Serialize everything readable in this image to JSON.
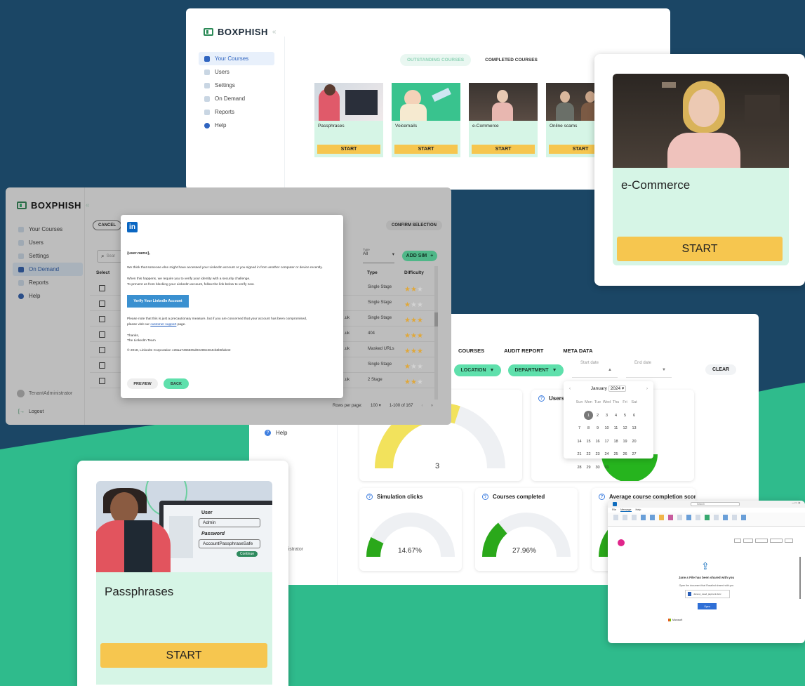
{
  "colors": {
    "bg_navy": "#1b4665",
    "bg_green": "#2fbb8c",
    "accent_green": "#5fe0ac",
    "start_yellow": "#f6c64f",
    "card_mint": "#d6f5e6",
    "linkedin_blue": "#0a66c2"
  },
  "courses_panel": {
    "logo": "BOXPHISH",
    "sidebar": [
      "Your Courses",
      "Users",
      "Settings",
      "On Demand",
      "Reports",
      "Help"
    ],
    "tabs": [
      "OUTSTANDING COURSES",
      "COMPLETED COURSES"
    ],
    "courses": [
      {
        "title": "Passphrases",
        "start": "START"
      },
      {
        "title": "Voicemails",
        "start": "START"
      },
      {
        "title": "e-Commerce",
        "start": "START"
      },
      {
        "title": "Online scams",
        "start": "START"
      }
    ]
  },
  "ecommerce_card": {
    "title": "e-Commerce",
    "start": "START"
  },
  "ondemand_panel": {
    "logo": "BOXPHISH",
    "sidebar": [
      "Your Courses",
      "Users",
      "Settings",
      "On Demand",
      "Reports",
      "Help"
    ],
    "tenant_admin": "TenantAdministrator",
    "logout": "Logout",
    "cancel": "CANCEL",
    "confirm": "CONFIRM SELECTION",
    "search_placeholder": "Sear",
    "type_filter_label": "Type",
    "type_filter_value": "All",
    "add_sim": "ADD SIM",
    "columns": {
      "select": "Select",
      "type": "Type",
      "difficulty": "Difficulty"
    },
    "rows": [
      {
        "partial": "",
        "type": "Single Stage",
        "stars": 2
      },
      {
        "partial": "",
        "type": "Single Stage",
        "stars": 1
      },
      {
        "partial": ".uk",
        "type": "Single Stage",
        "stars": 3
      },
      {
        "partial": ".uk",
        "type": "404",
        "stars": 3
      },
      {
        "partial": ".uk",
        "type": "Masked URLs",
        "stars": 3
      },
      {
        "partial": "",
        "type": "Single Stage",
        "stars": 1
      },
      {
        "partial": ".uk",
        "type": "2 Stage",
        "stars": 2
      }
    ],
    "pagination": {
      "rows_label": "Rows per page:",
      "rows_value": "100",
      "range": "1-100 of 167"
    }
  },
  "linkedin_modal": {
    "logo": "in",
    "greeting": "{user.name},",
    "p1": "We think that someone else might have accessed your LinkedIn account or you signed in from another computer or device recently.",
    "p2a": "When this happens, we require you to verify your identity with a security challenge.",
    "p2b": "To prevent us from blocking your LinkedIn account, follow the link below to verify now.",
    "verify_button": "Verify Your LinkedIn Account",
    "p3a": "Please note that this is just a precautionary measure, but if you are concerned that your account has been compromised,",
    "p3b_prefix": "please visit our ",
    "p3b_link": "customer support",
    "p3b_suffix": " page.",
    "thanks": "Thanks,",
    "team": "The LinkedIn Team",
    "copyright": "© 2018, LinkedIn Corporation c28aa7465505d03499e264cb6b5fab42",
    "preview": "PREVIEW",
    "back": "BACK"
  },
  "reports_panel": {
    "tabs": [
      "COURSES",
      "AUDIT REPORT",
      "META DATA"
    ],
    "filters": {
      "location": "LOCATION",
      "department": "DEPARTMENT",
      "start_date": "Start date",
      "end_date": "End date",
      "clear": "CLEAR"
    },
    "calendar": {
      "month": "January",
      "year": "2024",
      "weekdays": [
        "Sun",
        "Mon",
        "Tue",
        "Wed",
        "Thu",
        "Fri",
        "Sat"
      ],
      "weeks": [
        [
          "",
          "1",
          "2",
          "3",
          "4",
          "5",
          "6"
        ],
        [
          "7",
          "8",
          "9",
          "10",
          "11",
          "12",
          "13"
        ],
        [
          "14",
          "15",
          "16",
          "17",
          "18",
          "19",
          "20"
        ],
        [
          "21",
          "22",
          "23",
          "24",
          "25",
          "26",
          "27"
        ],
        [
          "28",
          "29",
          "30",
          "31",
          "",
          "",
          ""
        ]
      ],
      "selected": "1"
    },
    "sidebar_help": "Help",
    "admin_partial": "ryAdministrator",
    "users_card_title": "Users",
    "gauge_main": {
      "value": "3",
      "fraction": 0.6
    },
    "gauges": [
      {
        "title": "Simulation clicks",
        "value": "14.67%",
        "fraction": 0.1467
      },
      {
        "title": "Courses completed",
        "value": "27.96%",
        "fraction": 0.2796
      },
      {
        "title": "Average course completion score",
        "value": "",
        "fraction": 0.5
      }
    ]
  },
  "passphrases_card": {
    "user_label": "User",
    "user_value": "Admin",
    "password_label": "Password",
    "password_value": "AccountPassphraseSafe",
    "continue": "Continue",
    "title": "Passphrases",
    "start": "START"
  },
  "outlook_panel": {
    "search": "Search",
    "menu": [
      "File",
      "Message",
      "Help"
    ],
    "shared_title": "Jane.s File has been shared with you",
    "shared_sub": "Open the document that Rosalind shared with you",
    "file_name": "Jamesy_owed_payment.docx",
    "open_button": "Open",
    "microsoft": "Microsoft"
  }
}
